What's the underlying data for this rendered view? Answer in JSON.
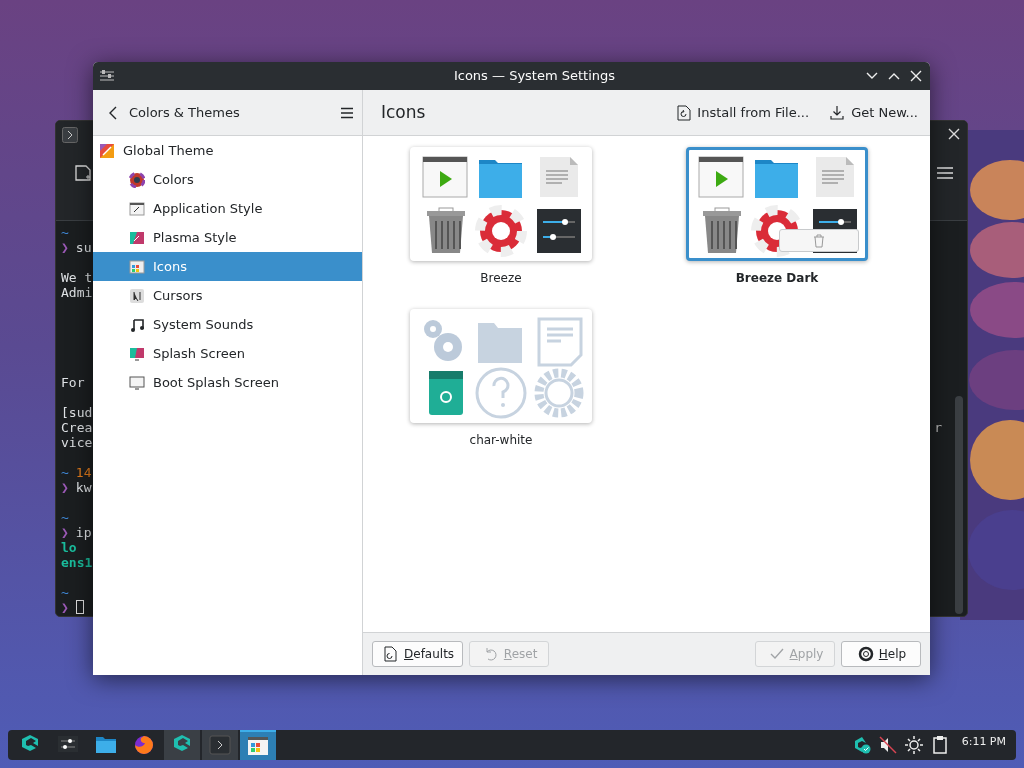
{
  "terminal": {
    "lines": [
      {
        "segments": [
          {
            "text": "~",
            "kind": "path"
          }
        ]
      },
      {
        "segments": [
          {
            "text": "❯",
            "kind": "prompt"
          },
          {
            "text": "su",
            "kind": "plain"
          }
        ]
      },
      {
        "kind": "blank"
      },
      {
        "segments": [
          {
            "text": "We t",
            "kind": "plain"
          }
        ]
      },
      {
        "segments": [
          {
            "text": "Admi",
            "kind": "plain"
          }
        ]
      },
      {
        "kind": "blank"
      },
      {
        "kind": "blank"
      },
      {
        "kind": "blank"
      },
      {
        "kind": "blank"
      },
      {
        "kind": "blank"
      },
      {
        "segments": [
          {
            "text": "For",
            "kind": "plain"
          }
        ]
      },
      {
        "kind": "blank"
      },
      {
        "segments": [
          {
            "text": "[sud",
            "kind": "plain"
          }
        ]
      },
      {
        "segments": [
          {
            "text": "Crea",
            "kind": "plain"
          }
        ],
        "tail": "r"
      },
      {
        "segments": [
          {
            "text": "vice",
            "kind": "plain"
          }
        ]
      },
      {
        "kind": "blank"
      },
      {
        "segments": [
          {
            "text": "~",
            "kind": "path"
          },
          {
            "text": "14",
            "kind": "number"
          }
        ]
      },
      {
        "segments": [
          {
            "text": "❯",
            "kind": "prompt"
          },
          {
            "text": "kw",
            "kind": "plain"
          }
        ]
      },
      {
        "kind": "blank"
      },
      {
        "segments": [
          {
            "text": "~",
            "kind": "path"
          }
        ]
      },
      {
        "segments": [
          {
            "text": "❯",
            "kind": "prompt"
          },
          {
            "text": "ip",
            "kind": "plain"
          }
        ]
      },
      {
        "segments": [
          {
            "text": "lo",
            "kind": "green"
          }
        ]
      },
      {
        "segments": [
          {
            "text": "ens1",
            "kind": "green"
          }
        ]
      },
      {
        "kind": "blank"
      },
      {
        "segments": [
          {
            "text": "~",
            "kind": "path"
          }
        ]
      },
      {
        "segments": [
          {
            "text": "❯",
            "kind": "prompt"
          }
        ],
        "cursor": true
      }
    ]
  },
  "window": {
    "title": "Icons — System Settings"
  },
  "header": {
    "back_label": "Colors & Themes",
    "page_title": "Icons",
    "actions": [
      {
        "label": "Install from File...",
        "kind": "install"
      },
      {
        "label": "Get New...",
        "kind": "download"
      }
    ]
  },
  "sidebar": {
    "items": [
      {
        "label": "Global Theme",
        "selected": false,
        "children": [
          {
            "label": "Colors",
            "selected": false
          },
          {
            "label": "Application Style",
            "selected": false
          },
          {
            "label": "Plasma Style",
            "selected": false
          },
          {
            "label": "Icons",
            "selected": true
          },
          {
            "label": "Cursors",
            "selected": false
          },
          {
            "label": "System Sounds",
            "selected": false
          },
          {
            "label": "Splash Screen",
            "selected": false
          },
          {
            "label": "Boot Splash Screen",
            "selected": false
          }
        ]
      }
    ]
  },
  "themes": [
    {
      "name": "Breeze",
      "selected": false,
      "kind": "breeze",
      "hovered": false
    },
    {
      "name": "Breeze Dark",
      "selected": true,
      "kind": "breeze",
      "hovered": true
    },
    {
      "name": "char-white",
      "selected": false,
      "kind": "flat",
      "hovered": false
    }
  ],
  "footer": {
    "buttons": [
      {
        "label": "Defaults",
        "kind": "defaults",
        "disabled": false,
        "mnemonic": true
      },
      {
        "label": "Reset",
        "kind": "reset",
        "disabled": true,
        "mnemonic": true
      },
      {
        "label": "Apply",
        "kind": "apply",
        "disabled": true,
        "mnemonic": true
      },
      {
        "label": "Help",
        "kind": "help",
        "disabled": false,
        "mnemonic": true
      }
    ]
  },
  "taskbar": {
    "tasks": [
      {
        "kind": "launcher",
        "open": false,
        "active": false
      },
      {
        "kind": "settings",
        "open": false,
        "active": false
      },
      {
        "kind": "files",
        "open": false,
        "active": false
      },
      {
        "kind": "browser",
        "open": false,
        "active": false
      },
      {
        "kind": "store",
        "open": true,
        "active": false
      },
      {
        "kind": "terminal",
        "open": true,
        "active": false
      },
      {
        "kind": "icons",
        "open": true,
        "active": true
      }
    ],
    "tray": [
      {
        "kind": "update"
      },
      {
        "kind": "muted"
      },
      {
        "kind": "brightness"
      },
      {
        "kind": "clipboard"
      }
    ],
    "clock": "6:11 PM"
  }
}
